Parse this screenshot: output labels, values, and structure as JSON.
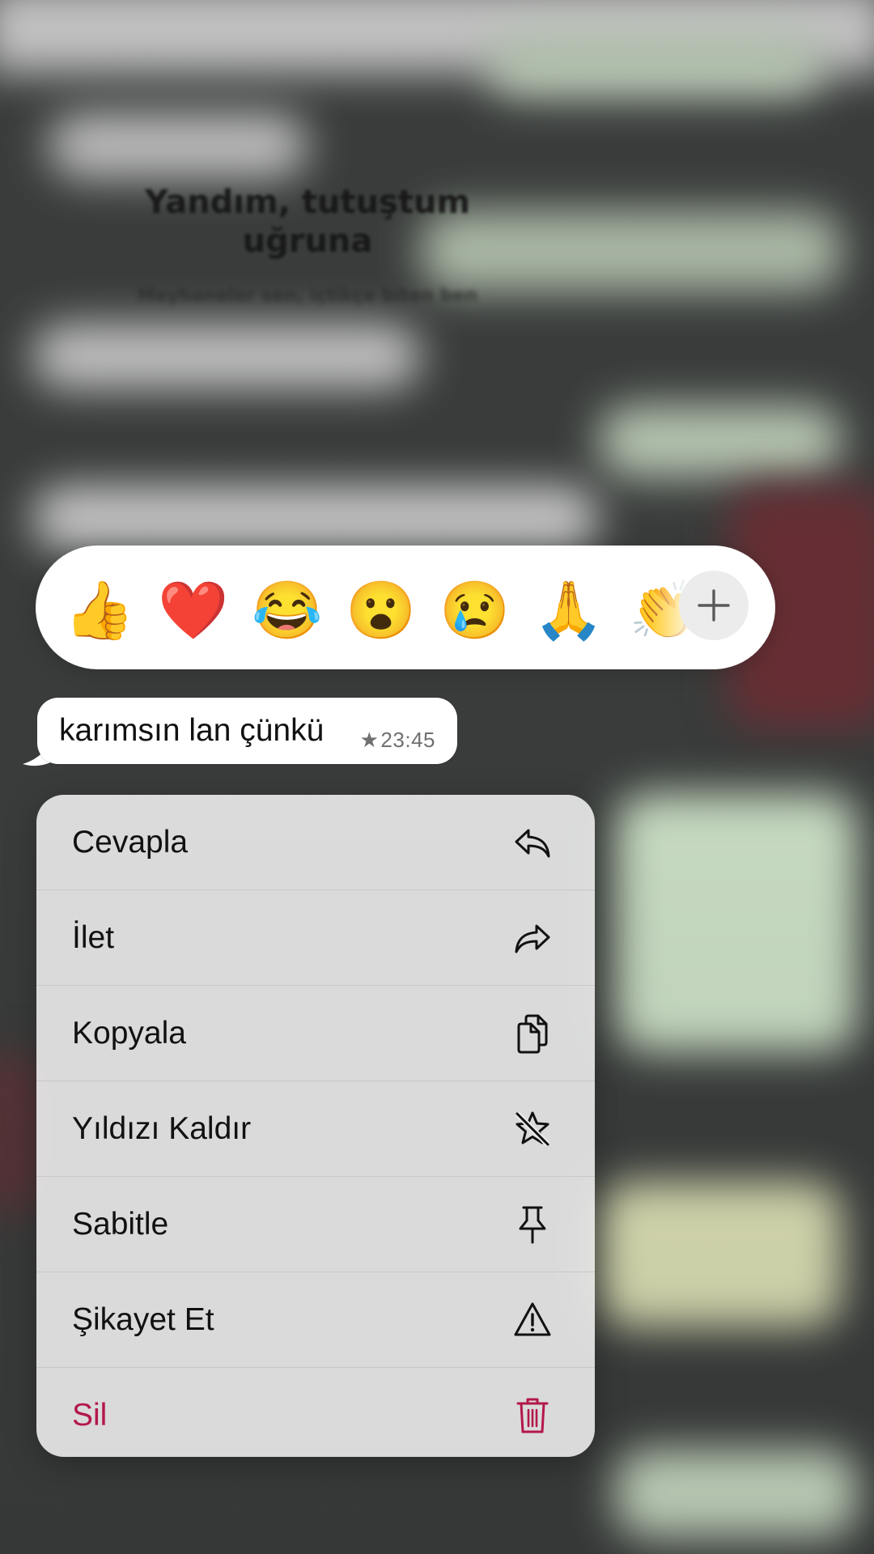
{
  "background": {
    "heading": "Yandım, tutuştum uğruna",
    "subheading": "Meyhaneler sen, içtikçe biten ben"
  },
  "reactions": {
    "emojis": [
      {
        "char": "👍",
        "name": "thumbs-up"
      },
      {
        "char": "❤️",
        "name": "red-heart"
      },
      {
        "char": "😂",
        "name": "tears-of-joy"
      },
      {
        "char": "😮",
        "name": "surprised-face"
      },
      {
        "char": "😢",
        "name": "crying-face"
      },
      {
        "char": "🙏",
        "name": "folded-hands"
      },
      {
        "char": "👏",
        "name": "clapping-hands"
      }
    ],
    "more_icon": "plus-icon"
  },
  "message": {
    "text": "karımsın lan çünkü",
    "star": "★",
    "time": "23:45"
  },
  "menu": {
    "items": [
      {
        "label": "Cevapla",
        "icon": "reply-icon"
      },
      {
        "label": "İlet",
        "icon": "forward-icon"
      },
      {
        "label": "Kopyala",
        "icon": "copy-icon"
      },
      {
        "label": "Yıldızı Kaldır",
        "icon": "unstar-icon"
      },
      {
        "label": "Sabitle",
        "icon": "pin-icon"
      },
      {
        "label": "Şikayet Et",
        "icon": "warning-icon"
      },
      {
        "label": "Sil",
        "icon": "trash-icon"
      }
    ]
  },
  "colors": {
    "danger": "#b3184a",
    "menu_background": "#ececec",
    "bubble_background": "#ffffff"
  }
}
